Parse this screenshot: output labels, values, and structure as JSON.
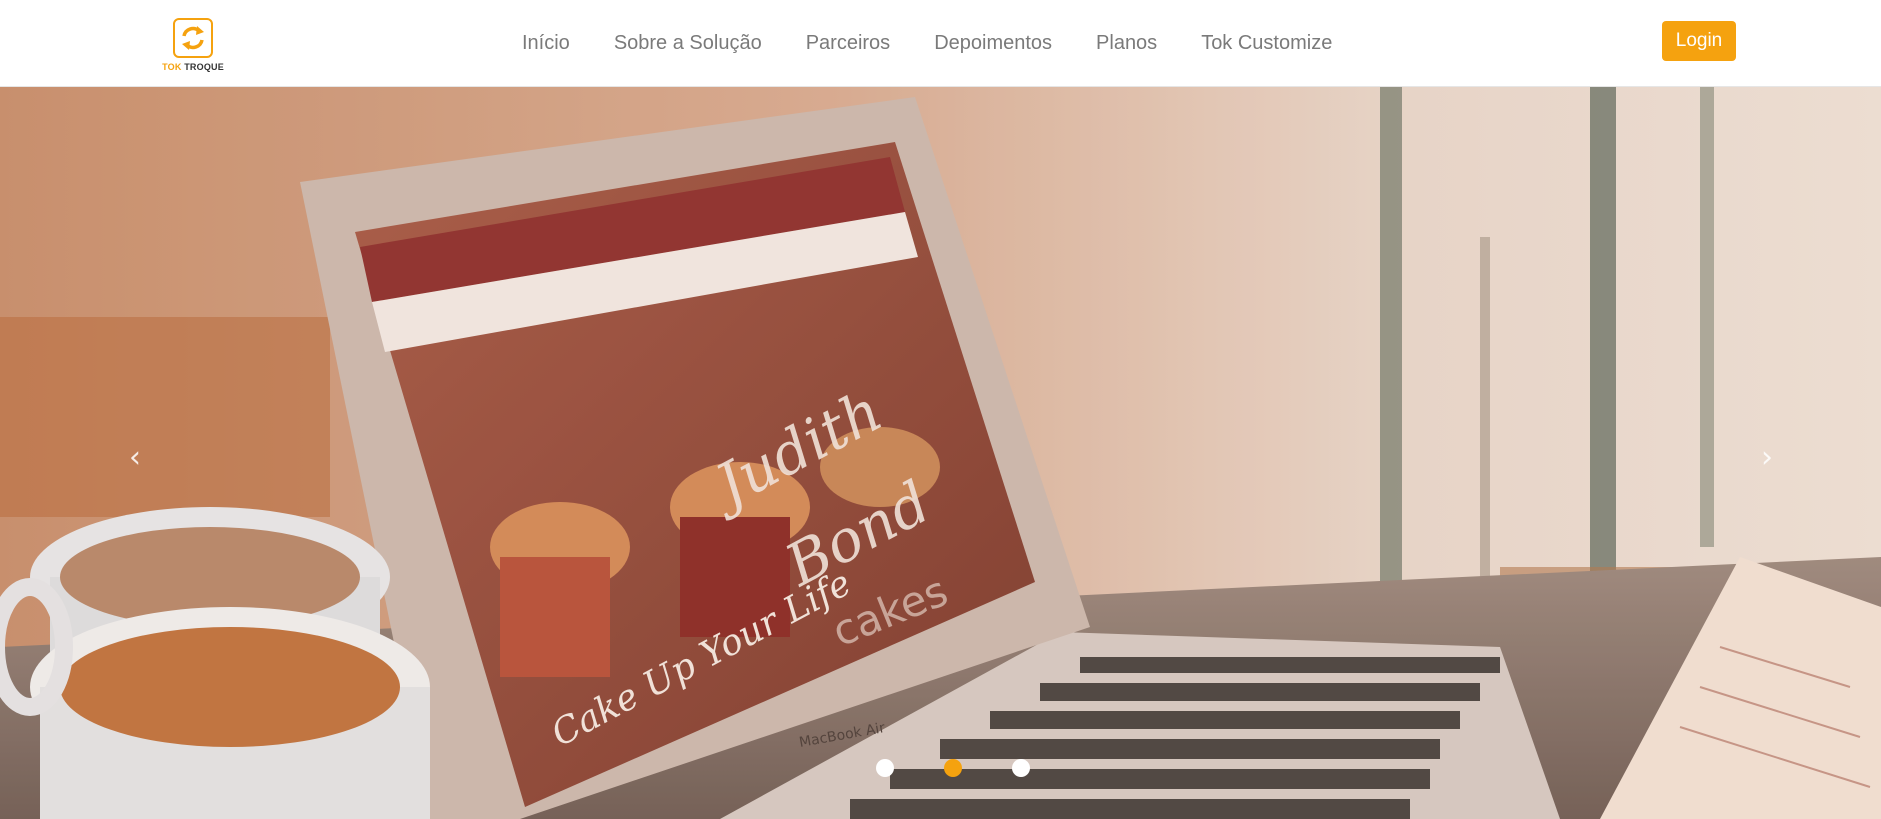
{
  "brand": {
    "name_part1": "TOK",
    "name_part2": "TROQUE",
    "accent_color": "#f5a20f",
    "logo_icon": "refresh-arrows-icon"
  },
  "nav": {
    "items": [
      {
        "label": "Início"
      },
      {
        "label": "Sobre a Solução"
      },
      {
        "label": "Parceiros"
      },
      {
        "label": "Depoimentos"
      },
      {
        "label": "Planos"
      },
      {
        "label": "Tok Customize"
      }
    ],
    "login_label": "Login"
  },
  "hero": {
    "prev_icon": "chevron-left-icon",
    "next_icon": "chevron-right-icon",
    "prev_glyph": "‹",
    "next_glyph": "›",
    "slides_total": 3,
    "active_slide": 2,
    "image_lettering": {
      "brand_script": "Judith Bond",
      "brand_sub": "cakes",
      "tagline": "Cake Up Your Life",
      "laptop_label": "MacBook Air"
    }
  }
}
